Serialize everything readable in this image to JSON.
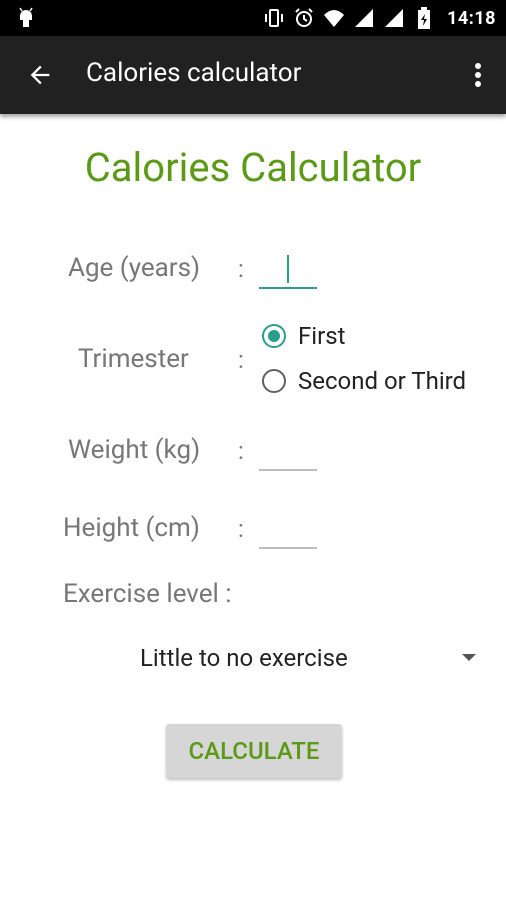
{
  "status_bar": {
    "time": "14:18",
    "icons": [
      "android-icon",
      "vibrate-icon",
      "alarm-icon",
      "wifi-icon",
      "signal-icon",
      "signal-icon",
      "battery-icon"
    ]
  },
  "app_bar": {
    "title": "Calories calculator",
    "back_icon": "arrow-left-icon",
    "menu_icon": "more-vert-icon"
  },
  "form": {
    "heading": "Calories Calculator",
    "age_label": "Age (years)",
    "trimester_label": "Trimester",
    "weight_label": "Weight (kg)",
    "height_label": "Height (cm)",
    "exercise_label": "Exercise level :",
    "colon": ":",
    "age_value": "",
    "weight_value": "",
    "height_value": "",
    "trimester_options": [
      "First",
      "Second or Third"
    ],
    "trimester_selected": "First",
    "exercise_selected": "Little to no exercise",
    "calculate_label": "CALCULATE"
  },
  "colors": {
    "accent": "#2a9d8f",
    "heading_green": "#5b9a16",
    "appbar": "#212121"
  }
}
